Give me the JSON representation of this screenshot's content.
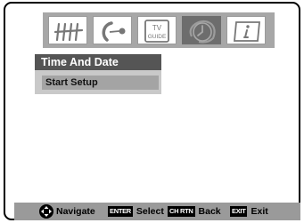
{
  "menu": {
    "title": "Time And Date",
    "items": [
      {
        "label": "Start Setup"
      }
    ]
  },
  "tabs": [
    {
      "icon": "antenna-icon",
      "active": false
    },
    {
      "icon": "satellite-dish-icon",
      "active": false
    },
    {
      "icon": "tv-guide-icon",
      "active": false,
      "text_line1": "TV",
      "text_line2": "GUIDE"
    },
    {
      "icon": "clock-icon",
      "active": true
    },
    {
      "icon": "info-icon",
      "active": false
    }
  ],
  "footer": {
    "navigate_label": "Navigate",
    "enter_key": "ENTER",
    "select_label": "Select",
    "chrtn_key": "CH RTN",
    "back_label": "Back",
    "exit_key": "EXIT",
    "exit_label": "Exit"
  }
}
